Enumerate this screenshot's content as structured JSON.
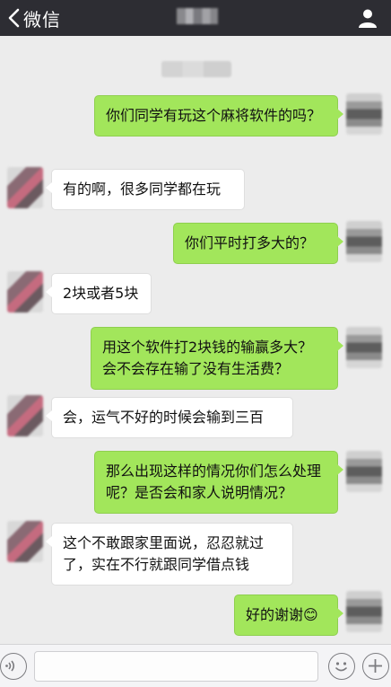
{
  "header": {
    "back_label": "微信"
  },
  "input": {
    "value": ""
  },
  "messages": [
    {
      "side": "right",
      "text": "你们同学有玩这个麻将软件的吗？"
    },
    {
      "side": "left",
      "text": "有的啊，很多同学都在玩"
    },
    {
      "side": "right",
      "text": "你们平时打多大的？"
    },
    {
      "side": "left",
      "text": "2块或者5块"
    },
    {
      "side": "right",
      "text": "用这个软件打2块钱的输赢多大？会不会存在输了没有生活费？"
    },
    {
      "side": "left",
      "text": "会，运气不好的时候会输到三百"
    },
    {
      "side": "right",
      "text": "那么出现这样的情况你们怎么处理呢？是否会和家人说明情况？"
    },
    {
      "side": "left",
      "text": "这个不敢跟家里面说，忍忍就过了，实在不行就跟同学借点钱"
    },
    {
      "side": "right",
      "text": "好的谢谢😊"
    }
  ],
  "colors": {
    "topbar": "#2d2d33",
    "bubble_right": "#a2e65b",
    "bubble_left": "#ffffff",
    "background": "#ececec"
  },
  "icons": {
    "back": "chevron-left-icon",
    "profile": "person-icon",
    "voice": "voice-icon",
    "emoji": "emoji-icon",
    "plus": "plus-icon"
  }
}
